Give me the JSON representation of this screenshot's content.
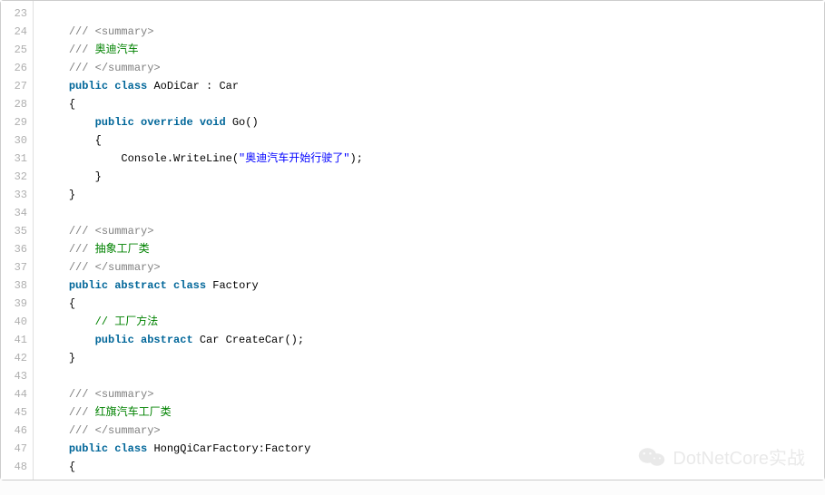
{
  "watermark": {
    "text": "DotNetCore实战",
    "icon": "wechat-icon"
  },
  "gutter_start": 23,
  "gutter_end": 48,
  "lines": [
    {
      "n": 23,
      "tokens": []
    },
    {
      "n": 24,
      "indent": 1,
      "tokens": [
        {
          "cls": "c-gray",
          "t": "/// <summary>"
        }
      ]
    },
    {
      "n": 25,
      "indent": 1,
      "tokens": [
        {
          "cls": "c-gray",
          "t": "/// "
        },
        {
          "cls": "c-comment",
          "t": "奥迪汽车"
        }
      ]
    },
    {
      "n": 26,
      "indent": 1,
      "tokens": [
        {
          "cls": "c-gray",
          "t": "/// </summary>"
        }
      ]
    },
    {
      "n": 27,
      "indent": 1,
      "tokens": [
        {
          "cls": "c-kw",
          "t": "public"
        },
        {
          "cls": "c-plain",
          "t": " "
        },
        {
          "cls": "c-kw",
          "t": "class"
        },
        {
          "cls": "c-plain",
          "t": " AoDiCar : Car"
        }
      ]
    },
    {
      "n": 28,
      "indent": 1,
      "tokens": [
        {
          "cls": "c-plain",
          "t": "{"
        }
      ]
    },
    {
      "n": 29,
      "indent": 2,
      "tokens": [
        {
          "cls": "c-kw",
          "t": "public"
        },
        {
          "cls": "c-plain",
          "t": " "
        },
        {
          "cls": "c-kw",
          "t": "override"
        },
        {
          "cls": "c-plain",
          "t": " "
        },
        {
          "cls": "c-kw",
          "t": "void"
        },
        {
          "cls": "c-plain",
          "t": " Go()"
        }
      ]
    },
    {
      "n": 30,
      "indent": 2,
      "tokens": [
        {
          "cls": "c-plain",
          "t": "{"
        }
      ]
    },
    {
      "n": 31,
      "indent": 3,
      "tokens": [
        {
          "cls": "c-plain",
          "t": "Console.WriteLine("
        },
        {
          "cls": "c-str",
          "t": "\"奥迪汽车开始行驶了\""
        },
        {
          "cls": "c-plain",
          "t": ");"
        }
      ]
    },
    {
      "n": 32,
      "indent": 2,
      "tokens": [
        {
          "cls": "c-plain",
          "t": "}"
        }
      ]
    },
    {
      "n": 33,
      "indent": 1,
      "tokens": [
        {
          "cls": "c-plain",
          "t": "}"
        }
      ]
    },
    {
      "n": 34,
      "tokens": []
    },
    {
      "n": 35,
      "indent": 1,
      "tokens": [
        {
          "cls": "c-gray",
          "t": "/// <summary>"
        }
      ]
    },
    {
      "n": 36,
      "indent": 1,
      "tokens": [
        {
          "cls": "c-gray",
          "t": "/// "
        },
        {
          "cls": "c-comment",
          "t": "抽象工厂类"
        }
      ]
    },
    {
      "n": 37,
      "indent": 1,
      "tokens": [
        {
          "cls": "c-gray",
          "t": "/// </summary>"
        }
      ]
    },
    {
      "n": 38,
      "indent": 1,
      "tokens": [
        {
          "cls": "c-kw",
          "t": "public"
        },
        {
          "cls": "c-plain",
          "t": " "
        },
        {
          "cls": "c-kw",
          "t": "abstract"
        },
        {
          "cls": "c-plain",
          "t": " "
        },
        {
          "cls": "c-kw",
          "t": "class"
        },
        {
          "cls": "c-plain",
          "t": " Factory"
        }
      ]
    },
    {
      "n": 39,
      "indent": 1,
      "tokens": [
        {
          "cls": "c-plain",
          "t": "{"
        }
      ]
    },
    {
      "n": 40,
      "indent": 2,
      "tokens": [
        {
          "cls": "c-comment",
          "t": "// 工厂方法"
        }
      ]
    },
    {
      "n": 41,
      "indent": 2,
      "tokens": [
        {
          "cls": "c-kw",
          "t": "public"
        },
        {
          "cls": "c-plain",
          "t": " "
        },
        {
          "cls": "c-kw",
          "t": "abstract"
        },
        {
          "cls": "c-plain",
          "t": " Car CreateCar();"
        }
      ]
    },
    {
      "n": 42,
      "indent": 1,
      "tokens": [
        {
          "cls": "c-plain",
          "t": "}"
        }
      ]
    },
    {
      "n": 43,
      "tokens": []
    },
    {
      "n": 44,
      "indent": 1,
      "tokens": [
        {
          "cls": "c-gray",
          "t": "/// <summary>"
        }
      ]
    },
    {
      "n": 45,
      "indent": 1,
      "tokens": [
        {
          "cls": "c-gray",
          "t": "/// "
        },
        {
          "cls": "c-comment",
          "t": "红旗汽车工厂类"
        }
      ]
    },
    {
      "n": 46,
      "indent": 1,
      "tokens": [
        {
          "cls": "c-gray",
          "t": "/// </summary>"
        }
      ]
    },
    {
      "n": 47,
      "indent": 1,
      "tokens": [
        {
          "cls": "c-kw",
          "t": "public"
        },
        {
          "cls": "c-plain",
          "t": " "
        },
        {
          "cls": "c-kw",
          "t": "class"
        },
        {
          "cls": "c-plain",
          "t": " HongQiCarFactory:Factory"
        }
      ]
    },
    {
      "n": 48,
      "indent": 1,
      "tokens": [
        {
          "cls": "c-plain",
          "t": "{"
        }
      ]
    }
  ]
}
